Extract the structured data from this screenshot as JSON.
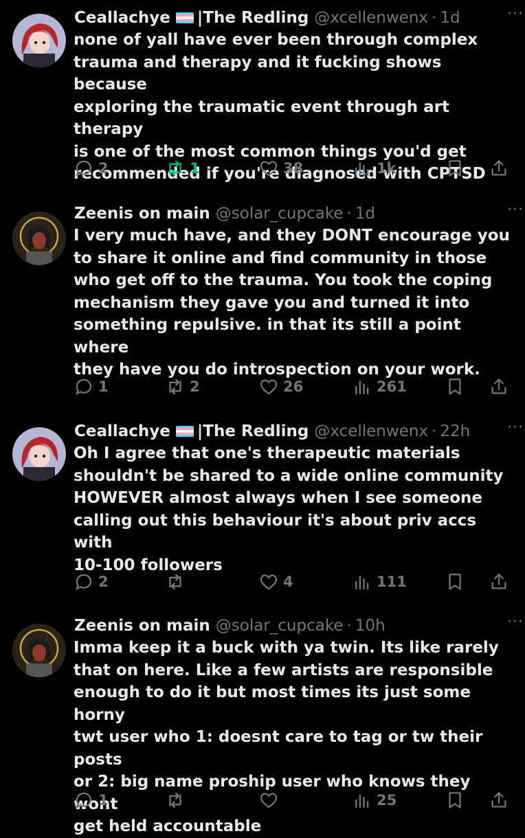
{
  "tweets": [
    {
      "display_name": "Ceallachye",
      "name_suffix": "|The Redling",
      "handle": "@xcellenwenx",
      "time": "1d",
      "text": "none of yall have ever been through complex\ntrauma and therapy and it fucking shows because\nexploring the traumatic event through art therapy\nis one of the most common things you'd get\nrecommended if you're diagnosed with CPTSD",
      "replies": "2",
      "reposts": "1",
      "likes": "38",
      "views": "1k"
    },
    {
      "display_name": "Zeenis on main",
      "name_suffix": "",
      "handle": "@solar_cupcake",
      "time": "1d",
      "text": "I very much have, and they DONT encourage you\nto share it online and find community in those\nwho get off to the trauma. You took the coping\nmechanism they gave you and turned it into\nsomething repulsive. in that its still a point where\nthey have you do introspection on your work.",
      "replies": "1",
      "reposts": "2",
      "likes": "26",
      "views": "261"
    },
    {
      "display_name": "Ceallachye",
      "name_suffix": "|The Redling",
      "handle": "@xcellenwenx",
      "time": "22h",
      "text": "Oh I agree that one's therapeutic materials\nshouldn't be shared to a wide online community\nHOWEVER almost always when I see someone\ncalling out this behaviour it's about priv accs with\n10-100 followers",
      "replies": "2",
      "reposts": "",
      "likes": "4",
      "views": "111"
    },
    {
      "display_name": "Zeenis on main",
      "name_suffix": "",
      "handle": "@solar_cupcake",
      "time": "10h",
      "text": "Imma keep it a buck with ya twin. Its like rarely\nthat on here. Like a few artists are responsible\nenough to do it but most times its just some horny\ntwt user who 1: doesnt care to tag or tw their posts\nor 2: big name proship user who knows they wont\nget held accountable",
      "replies": "1",
      "reposts": "",
      "likes": "",
      "views": "25"
    }
  ],
  "colors": {
    "background": "#000000",
    "text": "#e7e9ea",
    "muted": "#71767b",
    "repost_active": "#00ba7c",
    "trans_flag": [
      "#5bcefa",
      "#f5a9b8",
      "#ffffff"
    ]
  },
  "icons": {
    "reply": "speech-bubble-icon",
    "repost": "repost-arrows-icon",
    "like": "heart-icon",
    "views": "bar-chart-icon",
    "bookmark": "bookmark-icon",
    "share": "share-upload-icon",
    "more": "more-dots-icon"
  }
}
